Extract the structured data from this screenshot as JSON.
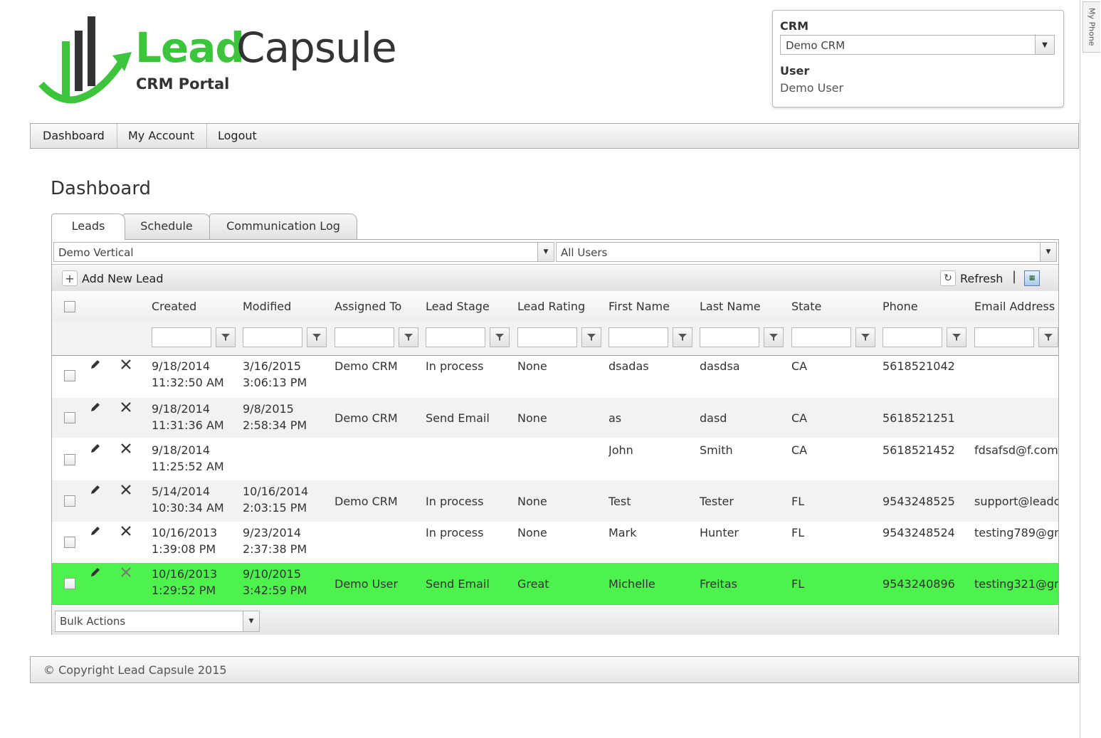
{
  "logo": {
    "lead": "Lead",
    "capsule": "Capsule",
    "subtitle": "CRM Portal"
  },
  "crm_panel": {
    "crm_label": "CRM",
    "crm_value": "Demo CRM",
    "user_label": "User",
    "user_value": "Demo User"
  },
  "nav": [
    "Dashboard",
    "My Account",
    "Logout"
  ],
  "page_title": "Dashboard",
  "tabs": [
    "Leads",
    "Schedule",
    "Communication Log"
  ],
  "filters": {
    "vertical": "Demo Vertical",
    "users": "All Users"
  },
  "toolbar": {
    "add_label": "Add New Lead",
    "refresh_label": "Refresh",
    "separator": "|"
  },
  "columns": [
    "Created",
    "Modified",
    "Assigned To",
    "Lead Stage",
    "Lead Rating",
    "First Name",
    "Last Name",
    "State",
    "Phone",
    "Email Address"
  ],
  "rows": [
    {
      "created": [
        "9/18/2014",
        "11:32:50 AM"
      ],
      "modified": [
        "3/16/2015",
        "3:06:13 PM"
      ],
      "assigned": "Demo CRM",
      "stage": "In process",
      "rating": "None",
      "first": "dsadas",
      "last": "dasdsa",
      "state": "CA",
      "phone": "5618521042",
      "email": ""
    },
    {
      "created": [
        "9/18/2014",
        "11:31:36 AM"
      ],
      "modified": [
        "9/8/2015",
        "2:58:34 PM"
      ],
      "assigned": "Demo CRM",
      "stage": "Send Email",
      "rating": "None",
      "first": "as",
      "last": "dasd",
      "state": "CA",
      "phone": "5618521251",
      "email": ""
    },
    {
      "created": [
        "9/18/2014",
        "11:25:52 AM"
      ],
      "modified": [
        "",
        ""
      ],
      "assigned": "",
      "stage": "",
      "rating": "",
      "first": "John",
      "last": "Smith",
      "state": "CA",
      "phone": "5618521452",
      "email": "fdsafsd@f.com"
    },
    {
      "created": [
        "5/14/2014",
        "10:30:34 AM"
      ],
      "modified": [
        "10/16/2014",
        "2:03:15 PM"
      ],
      "assigned": "Demo CRM",
      "stage": "In process",
      "rating": "None",
      "first": "Test",
      "last": "Tester",
      "state": "FL",
      "phone": "9543248525",
      "email": "support@leadc"
    },
    {
      "created": [
        "10/16/2013",
        "1:39:08 PM"
      ],
      "modified": [
        "9/23/2014",
        "2:37:38 PM"
      ],
      "assigned": "",
      "stage": "In process",
      "rating": "None",
      "first": "Mark",
      "last": "Hunter",
      "state": "FL",
      "phone": "9543248524",
      "email": "testing789@gm"
    },
    {
      "created": [
        "10/16/2013",
        "1:29:52 PM"
      ],
      "modified": [
        "9/10/2015",
        "3:42:59 PM"
      ],
      "assigned": "Demo User",
      "stage": "Send Email",
      "rating": "Great",
      "first": "Michelle",
      "last": "Freitas",
      "state": "FL",
      "phone": "9543240896",
      "email": "testing321@gm"
    }
  ],
  "bulk_actions": "Bulk Actions",
  "footer": "© Copyright Lead Capsule 2015",
  "side_tab": "My Phone",
  "colors": {
    "brand_green": "#3cc43c",
    "highlight_row": "#4df24d"
  }
}
